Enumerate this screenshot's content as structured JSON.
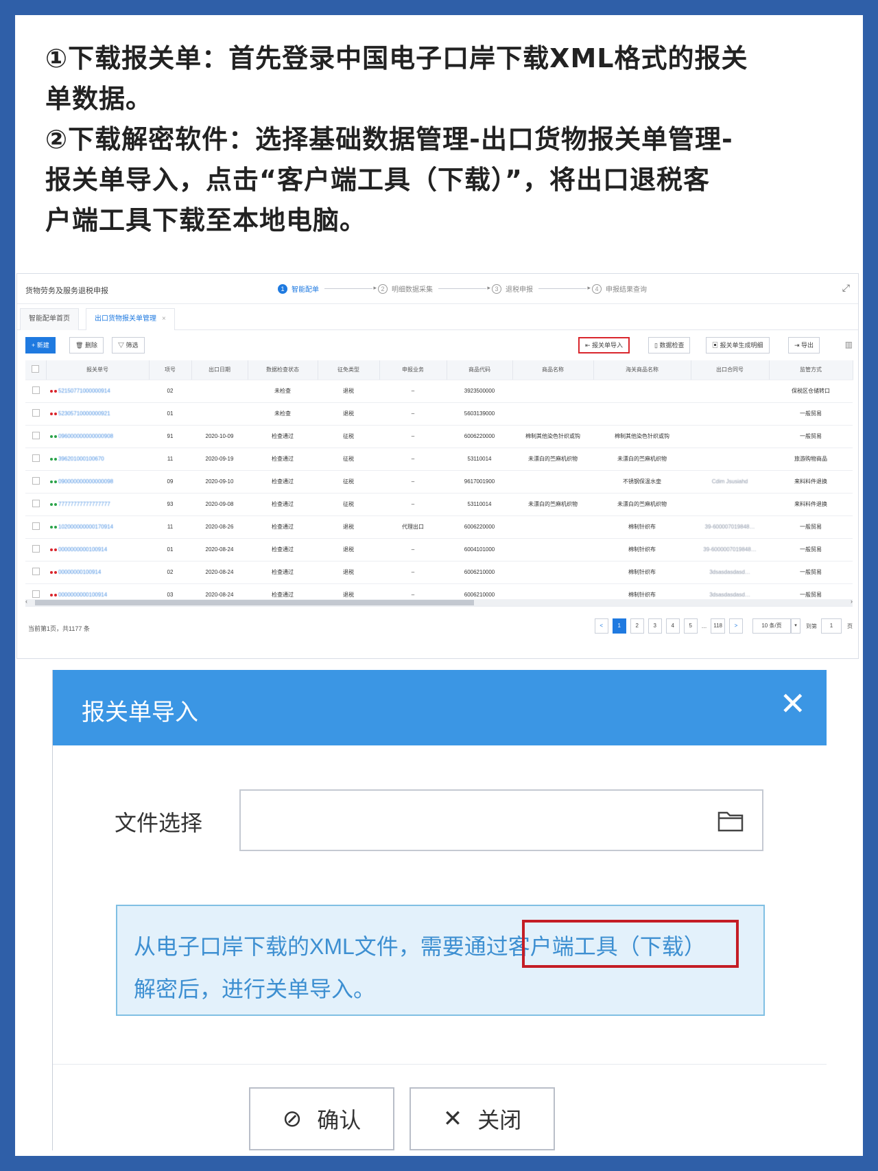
{
  "instructions": {
    "line1": "①下载报关单：首先登录中国电子口岸下载XML格式的报关",
    "line2": "单数据。",
    "line3": "②下载解密软件：选择基础数据管理-出口货物报关单管理-",
    "line4": "报关单导入，点击“客户端工具（下载）”，将出口退税客",
    "line5": "户端工具下载至本地电脑。"
  },
  "app": {
    "title": "货物劳务及服务退税申报",
    "steps": [
      {
        "num": "1",
        "label": "智能配单"
      },
      {
        "num": "2",
        "label": "明细数据采集"
      },
      {
        "num": "3",
        "label": "退税申报"
      },
      {
        "num": "4",
        "label": "申报结果查询"
      }
    ],
    "tabs": [
      {
        "label": "智能配单首页"
      },
      {
        "label": "出口货物报关单管理"
      }
    ],
    "toolbar": {
      "new": "+ 新建",
      "delete": "删除",
      "filter": "筛选",
      "import": "报关单导入",
      "check": "数据检查",
      "generate": "报关单生成明细",
      "export": "导出"
    },
    "columns": [
      "",
      "报关单号",
      "项号",
      "出口日期",
      "数据检查状态",
      "征免类型",
      "申报业务",
      "商品代码",
      "商品名称",
      "海关商品名称",
      "出口合同号",
      "监管方式"
    ],
    "rows": [
      {
        "dot": "#d9252c",
        "no": "52150771000000914",
        "item": "02",
        "date": "",
        "status": "未检查",
        "type": "退税",
        "biz": "–",
        "code": "3923500000",
        "name": "",
        "hgname": "",
        "contract": "",
        "mode": "保税区仓储转口"
      },
      {
        "dot": "#d9252c",
        "no": "52305710000000921",
        "item": "01",
        "date": "",
        "status": "未检查",
        "type": "退税",
        "biz": "–",
        "code": "5603139000",
        "name": "",
        "hgname": "",
        "contract": "",
        "mode": "一般贸易"
      },
      {
        "dot": "#2aa34a",
        "no": "096000000000000908",
        "item": "91",
        "date": "2020-10-09",
        "status": "检查通过",
        "type": "征税",
        "biz": "–",
        "code": "6006220000",
        "name": "棉制其他染色针织或钩",
        "hgname": "棉制其他染色针织或钩",
        "contract": "",
        "mode": "一般贸易"
      },
      {
        "dot": "#2aa34a",
        "no": "396201000100670",
        "item": "11",
        "date": "2020-09-19",
        "status": "检查通过",
        "type": "征税",
        "biz": "–",
        "code": "53110014",
        "name": "未漂白的苎麻机织物",
        "hgname": "未漂白的苎麻机织物",
        "contract": "",
        "mode": "旅游购物商品"
      },
      {
        "dot": "#2aa34a",
        "no": "090000000000000098",
        "item": "09",
        "date": "2020-09-10",
        "status": "检查通过",
        "type": "征税",
        "biz": "–",
        "code": "9617001900",
        "name": "",
        "hgname": "不锈钢保温水壶",
        "contract": "Cdim Jsusiahd",
        "mode": "来料料件退换"
      },
      {
        "dot": "#2aa34a",
        "no": "77777777777777777",
        "item": "93",
        "date": "2020-09-08",
        "status": "检查通过",
        "type": "征税",
        "biz": "–",
        "code": "53110014",
        "name": "未漂白的苎麻机织物",
        "hgname": "未漂白的苎麻机织物",
        "contract": "",
        "mode": "来料料件退换"
      },
      {
        "dot": "#2aa34a",
        "no": "102000000000170914",
        "item": "11",
        "date": "2020-08-26",
        "status": "检查通过",
        "type": "退税",
        "biz": "代理出口",
        "code": "6006220000",
        "name": "",
        "hgname": "棉制针织布",
        "contract": "39-600007019848…",
        "mode": "一般贸易"
      },
      {
        "dot": "#d9252c",
        "no": "0000000000100914",
        "item": "01",
        "date": "2020-08-24",
        "status": "检查通过",
        "type": "退税",
        "biz": "–",
        "code": "6004101000",
        "name": "",
        "hgname": "棉制针织布",
        "contract": "39-6000007019848…",
        "mode": "一般贸易"
      },
      {
        "dot": "#d9252c",
        "no": "00000000100914",
        "item": "02",
        "date": "2020-08-24",
        "status": "检查通过",
        "type": "退税",
        "biz": "–",
        "code": "6006210000",
        "name": "",
        "hgname": "棉制针织布",
        "contract": "3dsasdasdasd…",
        "mode": "一般贸易"
      },
      {
        "dot": "#d9252c",
        "no": "0000000000100914",
        "item": "03",
        "date": "2020-08-24",
        "status": "检查通过",
        "type": "退税",
        "biz": "–",
        "code": "6006210000",
        "name": "",
        "hgname": "棉制针织布",
        "contract": "3dsasdasdasd…",
        "mode": "一般贸易"
      }
    ],
    "total": "当前第1页，共1177 条",
    "pager": {
      "prev": "<",
      "pages": [
        "1",
        "2",
        "3",
        "4",
        "5"
      ],
      "ellipsis": "...",
      "last": "118",
      "next": ">",
      "page_size": "10 条/页",
      "goto": "到第",
      "goto_value": "1",
      "page_unit": "页"
    }
  },
  "dialog": {
    "title": "报关单导入",
    "file_label": "文件选择",
    "file_value": "",
    "notice_line1": "从电子口岸下载的XML文件，需要通过客户端工具（下载）",
    "notice_line2": "解密后，进行关单导入。",
    "confirm": "确认",
    "close": "关闭"
  }
}
